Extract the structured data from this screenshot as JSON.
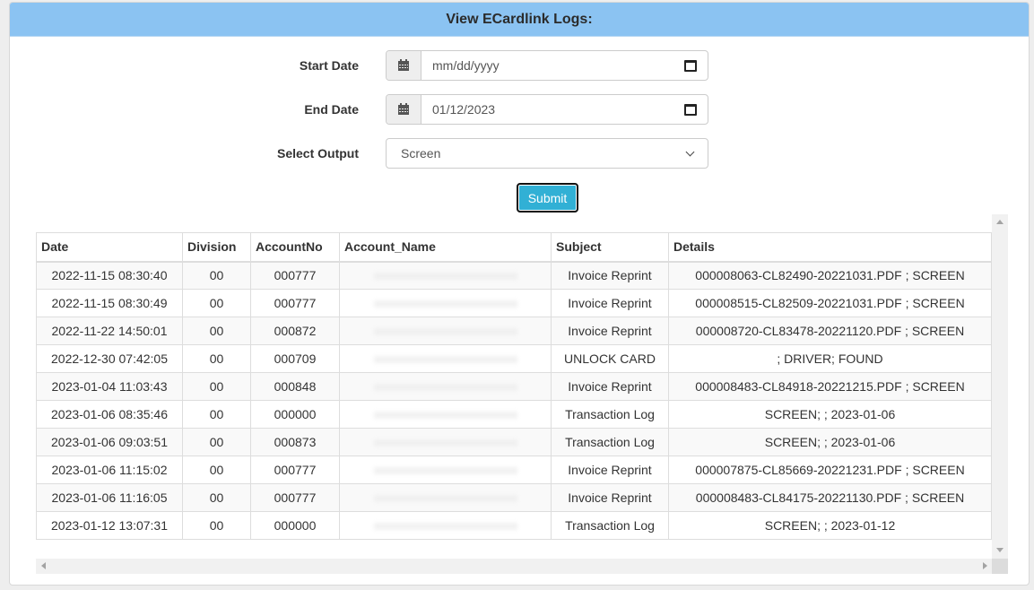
{
  "header": {
    "title": "View ECardlink Logs:"
  },
  "form": {
    "start_date": {
      "label": "Start Date",
      "value": "mm/dd/yyyy",
      "icon": "calendar-icon"
    },
    "end_date": {
      "label": "End Date",
      "value": "01/12/2023",
      "icon": "calendar-icon"
    },
    "output": {
      "label": "Select Output",
      "selected": "Screen"
    },
    "submit_label": "Submit"
  },
  "colors": {
    "header_bg": "#8bc3f2",
    "submit_bg": "#31b0d5"
  },
  "table": {
    "columns": [
      "Date",
      "Division",
      "AccountNo",
      "Account_Name",
      "Subject",
      "Details"
    ],
    "rows": [
      {
        "date": "2022-11-15 08:30:40",
        "division": "00",
        "account_no": "000777",
        "account_name": "",
        "subject": "Invoice Reprint",
        "details": "000008063-CL82490-20221031.PDF ; SCREEN"
      },
      {
        "date": "2022-11-15 08:30:49",
        "division": "00",
        "account_no": "000777",
        "account_name": "",
        "subject": "Invoice Reprint",
        "details": "000008515-CL82509-20221031.PDF ; SCREEN"
      },
      {
        "date": "2022-11-22 14:50:01",
        "division": "00",
        "account_no": "000872",
        "account_name": "",
        "subject": "Invoice Reprint",
        "details": "000008720-CL83478-20221120.PDF ; SCREEN"
      },
      {
        "date": "2022-12-30 07:42:05",
        "division": "00",
        "account_no": "000709",
        "account_name": "",
        "subject": "UNLOCK CARD",
        "details": "; DRIVER; FOUND"
      },
      {
        "date": "2023-01-04 11:03:43",
        "division": "00",
        "account_no": "000848",
        "account_name": "",
        "subject": "Invoice Reprint",
        "details": "000008483-CL84918-20221215.PDF ; SCREEN"
      },
      {
        "date": "2023-01-06 08:35:46",
        "division": "00",
        "account_no": "000000",
        "account_name": "",
        "subject": "Transaction Log",
        "details": "SCREEN; ; 2023-01-06"
      },
      {
        "date": "2023-01-06 09:03:51",
        "division": "00",
        "account_no": "000873",
        "account_name": "",
        "subject": "Transaction Log",
        "details": "SCREEN; ; 2023-01-06"
      },
      {
        "date": "2023-01-06 11:15:02",
        "division": "00",
        "account_no": "000777",
        "account_name": "",
        "subject": "Invoice Reprint",
        "details": "000007875-CL85669-20221231.PDF ; SCREEN"
      },
      {
        "date": "2023-01-06 11:16:05",
        "division": "00",
        "account_no": "000777",
        "account_name": "",
        "subject": "Invoice Reprint",
        "details": "000008483-CL84175-20221130.PDF ; SCREEN"
      },
      {
        "date": "2023-01-12 13:07:31",
        "division": "00",
        "account_no": "000000",
        "account_name": "",
        "subject": "Transaction Log",
        "details": "SCREEN; ; 2023-01-12"
      }
    ]
  }
}
